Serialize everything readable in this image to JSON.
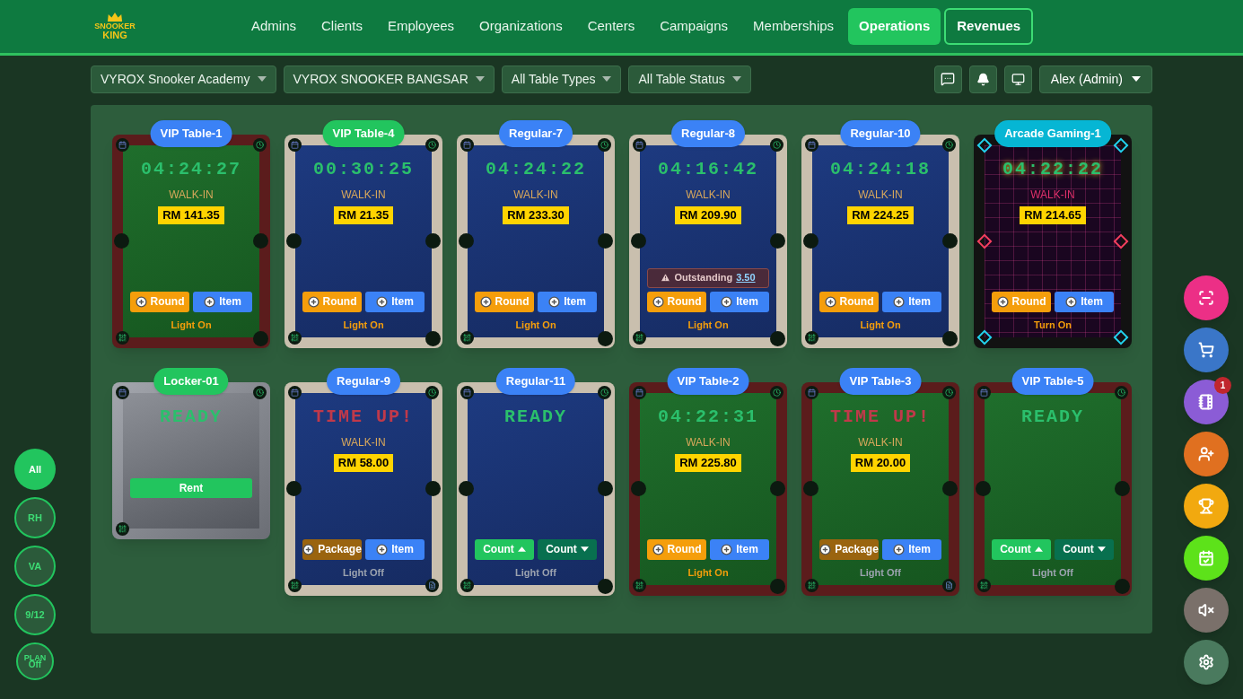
{
  "logo": {
    "line1": "SNOOKER",
    "line2": "KING"
  },
  "nav": [
    {
      "label": "Admins",
      "selected": false,
      "outlined": false
    },
    {
      "label": "Clients",
      "selected": false,
      "outlined": false
    },
    {
      "label": "Employees",
      "selected": false,
      "outlined": false
    },
    {
      "label": "Organizations",
      "selected": false,
      "outlined": false
    },
    {
      "label": "Centers",
      "selected": false,
      "outlined": false
    },
    {
      "label": "Campaigns",
      "selected": false,
      "outlined": false
    },
    {
      "label": "Memberships",
      "selected": false,
      "outlined": false
    },
    {
      "label": "Operations",
      "selected": true,
      "outlined": false
    },
    {
      "label": "Revenues",
      "selected": false,
      "outlined": true
    }
  ],
  "filters": [
    "VYROX Snooker Academy",
    "VYROX SNOOKER BANGSAR",
    "All Table Types",
    "All Table Status"
  ],
  "user_menu": "Alex (Admin)",
  "tables": [
    {
      "name": "VIP Table-1",
      "color": "#3b82f6",
      "kind": "vip",
      "timer": "04:24:27",
      "time_up": false,
      "customer": "WALK-IN",
      "amount": "RM 141.35",
      "buttons": [
        {
          "label": "Round",
          "kind": "round"
        },
        {
          "label": "Item",
          "kind": "item"
        }
      ],
      "light": {
        "label": "Light On",
        "on": true
      },
      "receipt": false
    },
    {
      "name": "VIP Table-4",
      "color": "#22c55e",
      "kind": "regular",
      "timer": "00:30:25",
      "time_up": false,
      "customer": "WALK-IN",
      "amount": "RM 21.35",
      "buttons": [
        {
          "label": "Round",
          "kind": "round"
        },
        {
          "label": "Item",
          "kind": "item"
        }
      ],
      "light": {
        "label": "Light On",
        "on": true
      },
      "receipt": false
    },
    {
      "name": "Regular-7",
      "color": "#3b82f6",
      "kind": "regular",
      "timer": "04:24:22",
      "time_up": false,
      "customer": "WALK-IN",
      "amount": "RM 233.30",
      "buttons": [
        {
          "label": "Round",
          "kind": "round"
        },
        {
          "label": "Item",
          "kind": "item"
        }
      ],
      "light": {
        "label": "Light On",
        "on": true
      },
      "receipt": false
    },
    {
      "name": "Regular-8",
      "color": "#3b82f6",
      "kind": "regular",
      "timer": "04:16:42",
      "time_up": false,
      "customer": "WALK-IN",
      "amount": "RM 209.90",
      "outstanding": {
        "label": "Outstanding",
        "amount": "3.50"
      },
      "buttons": [
        {
          "label": "Round",
          "kind": "round"
        },
        {
          "label": "Item",
          "kind": "item"
        }
      ],
      "light": {
        "label": "Light On",
        "on": true
      },
      "receipt": false
    },
    {
      "name": "Regular-10",
      "color": "#3b82f6",
      "kind": "regular",
      "timer": "04:24:18",
      "time_up": false,
      "customer": "WALK-IN",
      "amount": "RM 224.25",
      "buttons": [
        {
          "label": "Round",
          "kind": "round"
        },
        {
          "label": "Item",
          "kind": "item"
        }
      ],
      "light": {
        "label": "Light On",
        "on": true
      },
      "receipt": false
    },
    {
      "name": "Arcade Gaming-1",
      "color": "#06b6d4",
      "kind": "arcade",
      "timer": "04:22:22",
      "time_up": false,
      "customer": "WALK-IN",
      "amount": "RM 214.65",
      "buttons": [
        {
          "label": "Round",
          "kind": "round"
        },
        {
          "label": "Item",
          "kind": "item"
        }
      ],
      "light": {
        "label": "Turn On",
        "on": true
      }
    },
    {
      "name": "Locker-01",
      "color": "#22c55e",
      "kind": "locker",
      "timer": "READY",
      "time_up": false,
      "buttons": [
        {
          "label": "Rent",
          "kind": "rent"
        }
      ],
      "receipt": false
    },
    {
      "name": "Regular-9",
      "color": "#3b82f6",
      "kind": "regular",
      "timer": "TIME UP!",
      "time_up": true,
      "customer": "WALK-IN",
      "amount": "RM 58.00",
      "buttons": [
        {
          "label": "Package",
          "kind": "package"
        },
        {
          "label": "Item",
          "kind": "item"
        }
      ],
      "light": {
        "label": "Light Off",
        "on": false
      },
      "receipt": true
    },
    {
      "name": "Regular-11",
      "color": "#3b82f6",
      "kind": "regular",
      "timer": "READY",
      "time_up": false,
      "buttons": [
        {
          "label": "Count",
          "kind": "count_up"
        },
        {
          "label": "Count",
          "kind": "count_down"
        }
      ],
      "light": {
        "label": "Light Off",
        "on": false
      },
      "receipt": false
    },
    {
      "name": "VIP Table-2",
      "color": "#3b82f6",
      "kind": "vip",
      "timer": "04:22:31",
      "time_up": false,
      "customer": "WALK-IN",
      "amount": "RM 225.80",
      "buttons": [
        {
          "label": "Round",
          "kind": "round"
        },
        {
          "label": "Item",
          "kind": "item"
        }
      ],
      "light": {
        "label": "Light On",
        "on": true
      },
      "receipt": false
    },
    {
      "name": "VIP Table-3",
      "color": "#3b82f6",
      "kind": "vip",
      "timer": "TIME UP!",
      "time_up": true,
      "customer": "WALK-IN",
      "amount": "RM 20.00",
      "buttons": [
        {
          "label": "Package",
          "kind": "package"
        },
        {
          "label": "Item",
          "kind": "item"
        }
      ],
      "light": {
        "label": "Light Off",
        "on": false
      },
      "receipt": true
    },
    {
      "name": "VIP Table-5",
      "color": "#3b82f6",
      "kind": "vip",
      "timer": "READY",
      "time_up": false,
      "buttons": [
        {
          "label": "Count",
          "kind": "count_up"
        },
        {
          "label": "Count",
          "kind": "count_down"
        }
      ],
      "light": {
        "label": "Light Off",
        "on": false
      },
      "receipt": false
    }
  ],
  "left_filters": [
    {
      "label": "All",
      "selected": true
    },
    {
      "label": "RH",
      "selected": false
    },
    {
      "label": "VA",
      "selected": false
    },
    {
      "label": "9/12",
      "selected": false
    }
  ],
  "plan_toggle": {
    "label": "PLAN",
    "value": "Off"
  },
  "actions": [
    {
      "kind": "scan",
      "color": "#ec2f86"
    },
    {
      "kind": "cart",
      "color": "#3a76c8"
    },
    {
      "kind": "book",
      "color": "#8b5cd6",
      "badge": "1"
    },
    {
      "kind": "user_add",
      "color": "#e07020"
    },
    {
      "kind": "trophy",
      "color": "#f2a90f"
    },
    {
      "kind": "calendar",
      "color": "#5de21a"
    },
    {
      "kind": "mute",
      "color": "#7a706a"
    },
    {
      "kind": "settings",
      "color": "#4a7a5e"
    }
  ]
}
